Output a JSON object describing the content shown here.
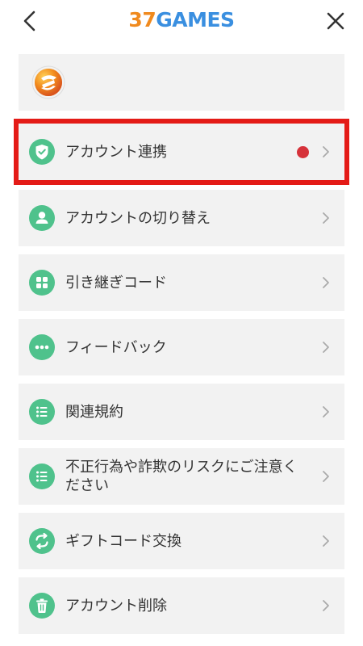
{
  "header": {
    "logo_number": "37",
    "logo_text": "GAMES",
    "back_icon": "chevron-left-icon",
    "close_icon": "close-icon"
  },
  "profile": {
    "avatar_icon": "game-logo-avatar"
  },
  "menu": {
    "items": [
      {
        "label": "アカウント連携",
        "icon": "shield-check-icon",
        "badge": "red-dot",
        "highlighted": true
      },
      {
        "label": "アカウントの切り替え",
        "icon": "user-icon"
      },
      {
        "label": "引き継ぎコード",
        "icon": "grid-icon"
      },
      {
        "label": "フィードバック",
        "icon": "ellipsis-icon"
      },
      {
        "label": "関連規約",
        "icon": "list-icon"
      },
      {
        "label": "不正行為や詐欺のリスクにご注意ください",
        "icon": "list-icon"
      },
      {
        "label": "ギフトコード交換",
        "icon": "exchange-icon"
      },
      {
        "label": "アカウント削除",
        "icon": "trash-icon"
      }
    ]
  },
  "colors": {
    "accent_green": "#4fc28c",
    "highlight_red": "#e41b17",
    "badge_red": "#d6323a",
    "logo_orange": "#f08a1e",
    "logo_blue": "#3a8fe0"
  }
}
